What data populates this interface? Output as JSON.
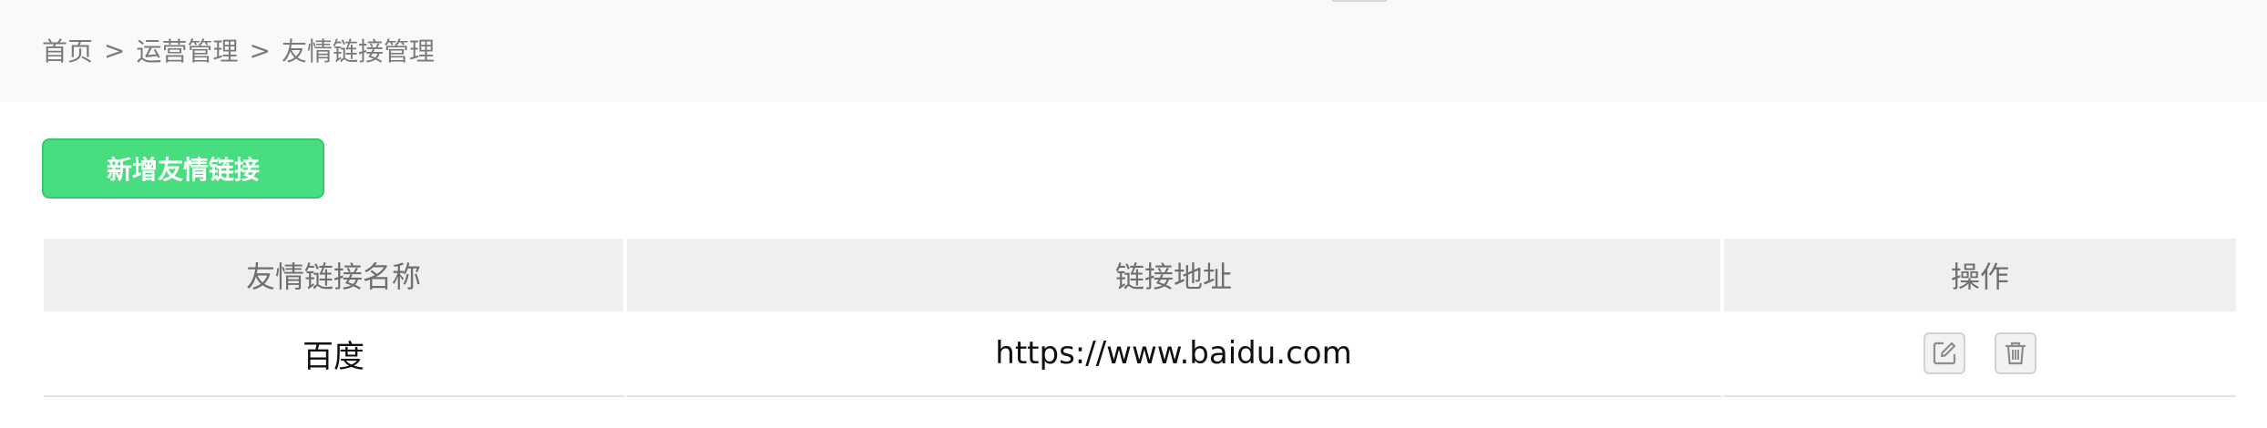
{
  "breadcrumb": {
    "home": "首页",
    "section": "运营管理",
    "current": "友情链接管理",
    "separator": ">"
  },
  "toolbar": {
    "add_label": "新增友情链接"
  },
  "table": {
    "headers": {
      "name": "友情链接名称",
      "url": "链接地址",
      "actions": "操作"
    },
    "rows": [
      {
        "name": "百度",
        "url": "https://www.baidu.com"
      }
    ]
  },
  "icons": {
    "edit": "edit-icon",
    "delete": "trash-icon"
  },
  "colors": {
    "primary_button": "#48dd7f",
    "header_bg": "#f9f9f9",
    "table_header_bg": "#efefef"
  }
}
